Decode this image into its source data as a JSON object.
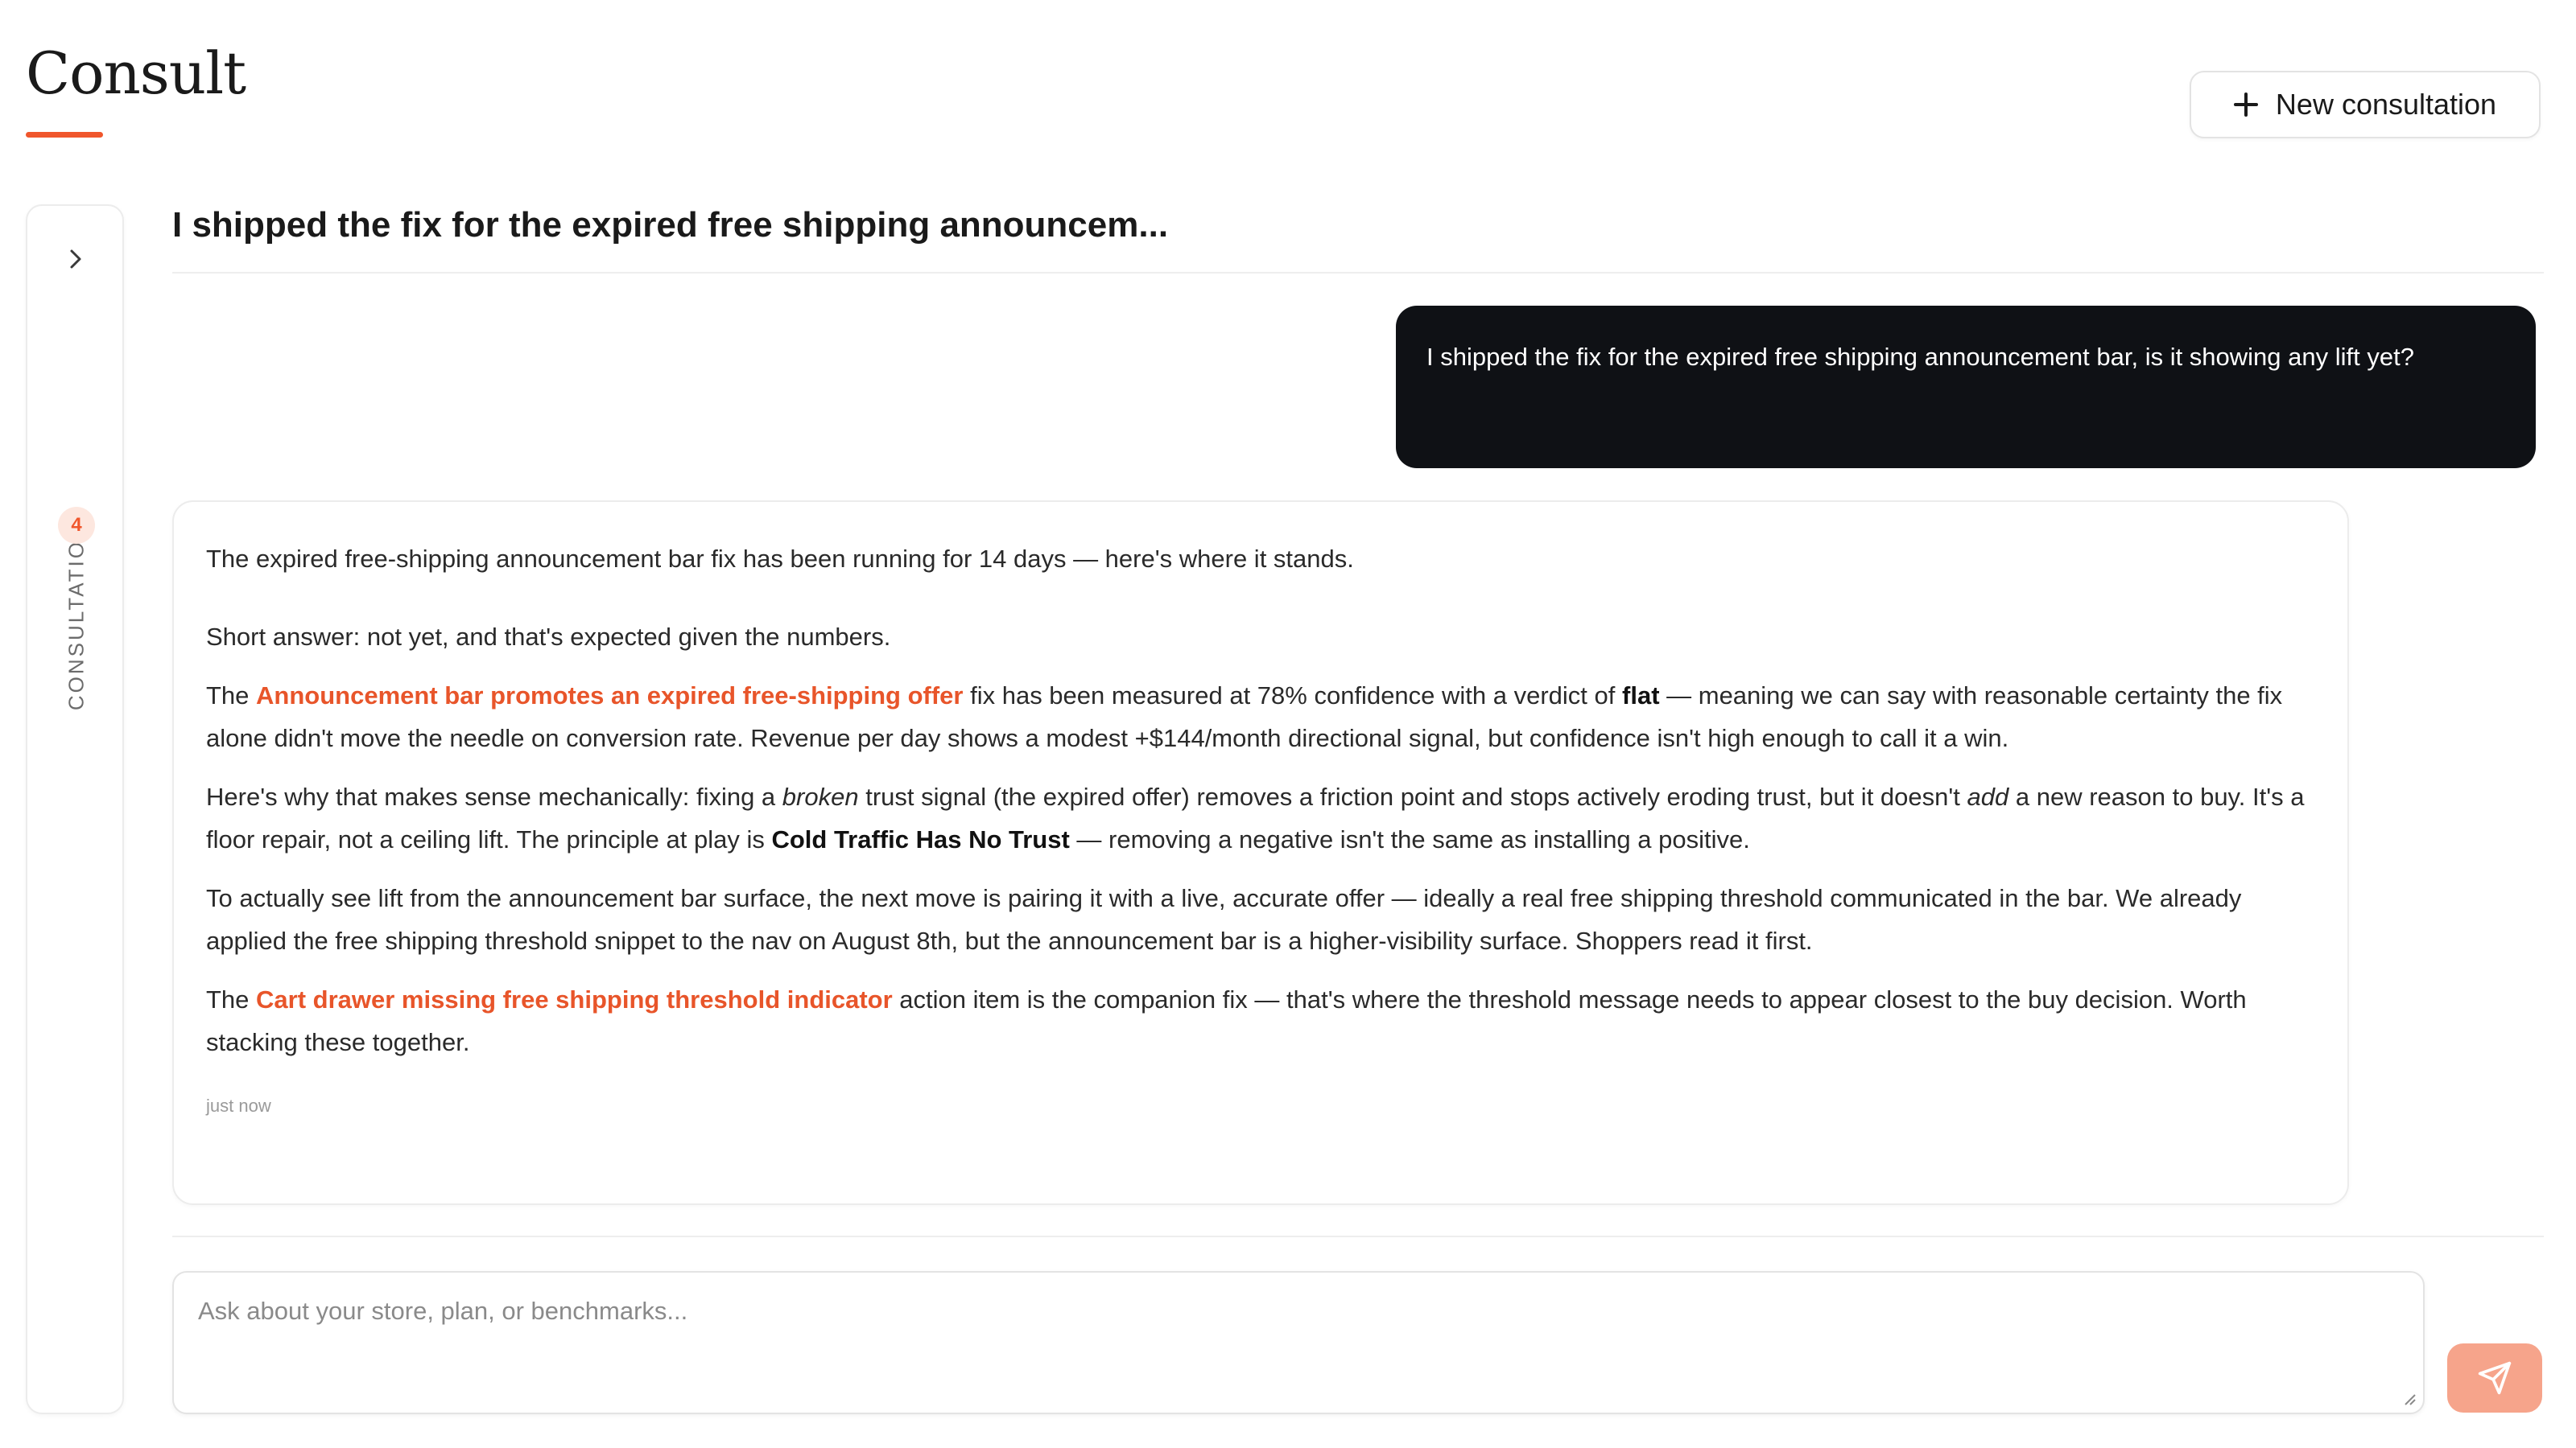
{
  "header": {
    "title": "Consult",
    "accent_color": "#f0562c",
    "new_button_label": "New consultation",
    "new_button_icon": "plus-icon"
  },
  "sidebar": {
    "label": "CONSULTATIONS",
    "count": "4",
    "toggle_icon": "chevron-right-icon"
  },
  "conversation": {
    "title": "I shipped the fix for the expired free shipping announcem...",
    "user_message": "I shipped the fix for the expired free shipping announcement bar, is it showing any lift yet?",
    "assistant": {
      "p1": "The expired free-shipping announcement bar fix has been running for 14 days — here's where it stands.",
      "p2": "Short answer: not yet, and that's expected given the numbers.",
      "p3": {
        "pre": "The ",
        "link": "Announcement bar promotes an expired free-shipping offer",
        "mid": " fix has been measured at 78% confidence with a verdict of ",
        "bold": "flat",
        "post": " — meaning we can say with reasonable certainty the fix alone didn't move the needle on conversion rate. Revenue per day shows a modest +$144/month directional signal, but confidence isn't high enough to call it a win."
      },
      "p4": {
        "pre": "Here's why that makes sense mechanically: fixing a ",
        "italic1": "broken",
        "mid1": " trust signal (the expired offer) removes a friction point and stops actively eroding trust, but it doesn't ",
        "italic2": "add",
        "mid2": " a new reason to buy. It's a floor repair, not a ceiling lift. The principle at play is ",
        "bold": "Cold Traffic Has No Trust",
        "post": " — removing a negative isn't the same as installing a positive."
      },
      "p5": "To actually see lift from the announcement bar surface, the next move is pairing it with a live, accurate offer — ideally a real free shipping threshold communicated in the bar. We already applied the free shipping threshold snippet to the nav on August 8th, but the announcement bar is a higher-visibility surface. Shoppers read it first.",
      "p6": {
        "pre": "The ",
        "link": "Cart drawer missing free shipping threshold indicator",
        "post": " action item is the companion fix — that's where the threshold message needs to appear closest to the buy decision. Worth stacking these together."
      },
      "timestamp": "just now",
      "link_color": "#e8552a"
    }
  },
  "composer": {
    "placeholder": "Ask about your store, plan, or benchmarks...",
    "value": "",
    "send_icon": "send-icon",
    "send_color": "#f6a48b"
  }
}
